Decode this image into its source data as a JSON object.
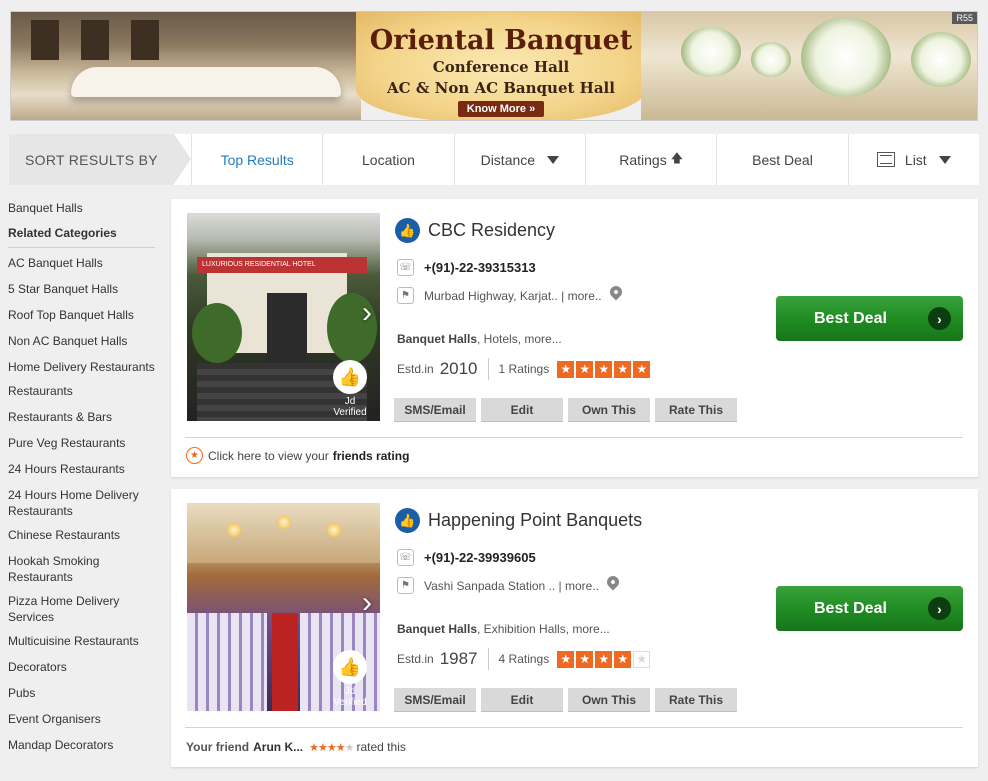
{
  "banner": {
    "title": "Oriental Banquet",
    "line1": "Conference Hall",
    "line2": "AC & Non AC Banquet Hall",
    "button": "Know More »",
    "tag": "R55"
  },
  "sortbar": {
    "label": "SORT RESULTS BY",
    "items": [
      "Top Results",
      "Location",
      "Distance",
      "Ratings",
      "Best Deal",
      "List"
    ],
    "active": "Top Results",
    "accent": "#1e7bc6"
  },
  "sidebar": {
    "top_item": "Banquet Halls",
    "heading": "Related Categories",
    "items": [
      "AC Banquet Halls",
      "5 Star Banquet Halls",
      "Roof Top Banquet Halls",
      "Non AC Banquet Halls",
      "Home Delivery Restaurants",
      "Restaurants",
      "Restaurants & Bars",
      "Pure Veg Restaurants",
      "24 Hours Restaurants",
      "24 Hours Home Delivery Restaurants",
      "Chinese Restaurants",
      "Hookah Smoking Restaurants",
      "Pizza Home Delivery Services",
      "Multicuisine Restaurants",
      "Decorators",
      "Pubs",
      "Event Organisers",
      "Mandap Decorators"
    ]
  },
  "listings": [
    {
      "name": "CBC Residency",
      "phone": "+(91)-22-39315313",
      "address": "Murbad Highway, Karjat.. | more..",
      "primary_category": "Banquet Halls",
      "other_categories": ", Hotels,  more...",
      "estd_label": "Estd.in",
      "estd_year": "2010",
      "ratings_text": "1 Ratings",
      "stars": 5,
      "photo_sign": "LUXURIOUS RESIDENTIAL HOTEL",
      "verified_text": "Jd Verified",
      "buttons": [
        "SMS/Email",
        "Edit",
        "Own This",
        "Rate This"
      ],
      "deal_label": "Best Deal",
      "footer_prefix": "Click here to view your",
      "footer_bold": "friends rating"
    },
    {
      "name": "Happening Point Banquets",
      "phone": "+(91)-22-39939605",
      "address": "Vashi Sanpada Station .. | more..",
      "primary_category": "Banquet Halls",
      "other_categories": ", Exhibition Halls,  more...",
      "estd_label": "Estd.in",
      "estd_year": "1987",
      "ratings_text": "4 Ratings",
      "stars": 4,
      "verified_text": "Jd Verified",
      "buttons": [
        "SMS/Email",
        "Edit",
        "Own This",
        "Rate This"
      ],
      "deal_label": "Best Deal",
      "friend_prefix": "Your friend",
      "friend_name": "Arun K...",
      "friend_stars": 4,
      "friend_suffix": "rated this"
    }
  ],
  "colors": {
    "star": "#ef6a21",
    "deal_green": "#1f8a22",
    "brand_blue": "#1a5ea8"
  }
}
